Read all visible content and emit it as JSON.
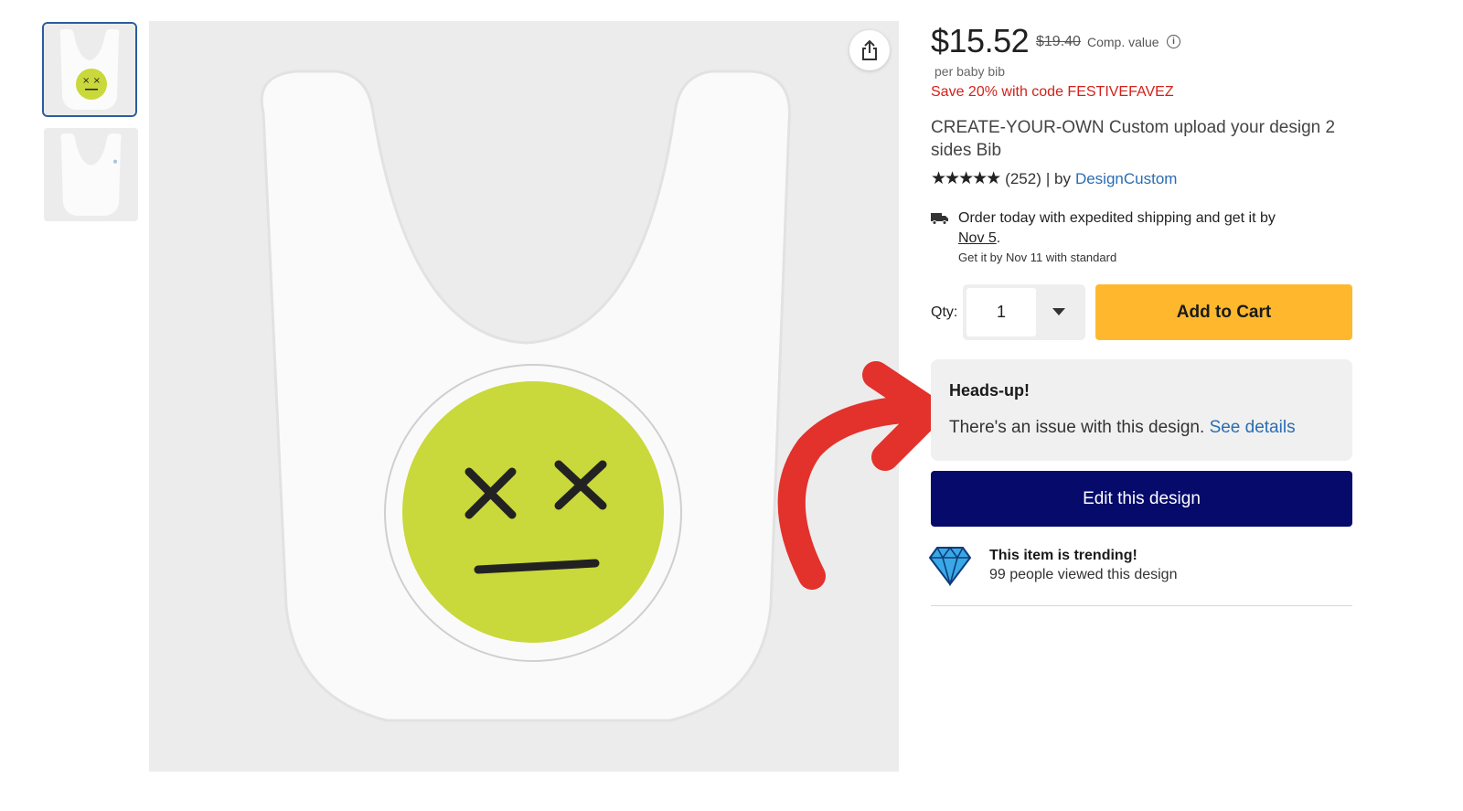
{
  "thumbnails": [
    {
      "label": "front view",
      "selected": true
    },
    {
      "label": "back view",
      "selected": false
    }
  ],
  "product": {
    "price": "$15.52",
    "old_price": "$19.40",
    "comp_label": "Comp. value",
    "per_unit": "per baby bib",
    "promo": "Save 20% with code FESTIVEFAVEZ",
    "title": "CREATE-YOUR-OWN Custom upload your design 2 sides Bib",
    "rating_stars": 4.5,
    "rating_count": "(252)",
    "by_label": "| by",
    "seller": "DesignCustom"
  },
  "shipping": {
    "line1": "Order today with expedited shipping and get it by",
    "date": "Nov 5",
    "line2_suffix": ".",
    "standard": "Get it by Nov 11 with standard"
  },
  "cart": {
    "qty_label": "Qty:",
    "qty_value": "1",
    "add_label": "Add to Cart"
  },
  "notice": {
    "title": "Heads-up!",
    "body": "There's an issue with this design.",
    "link": "See details"
  },
  "edit": {
    "label": "Edit this design"
  },
  "trending": {
    "title": "This item is trending!",
    "subtitle": "99 people viewed this design"
  },
  "colors": {
    "add_to_cart": "#ffb82e",
    "edit_button": "#050a6b",
    "promo": "#d2211a",
    "link": "#2a6db2",
    "arrow": "#e3312b",
    "face": "#c9d83a"
  },
  "icons": {
    "share": "share-icon",
    "info": "info-icon",
    "truck": "truck-icon",
    "caret": "chevron-down-icon",
    "diamond": "diamond-icon"
  }
}
